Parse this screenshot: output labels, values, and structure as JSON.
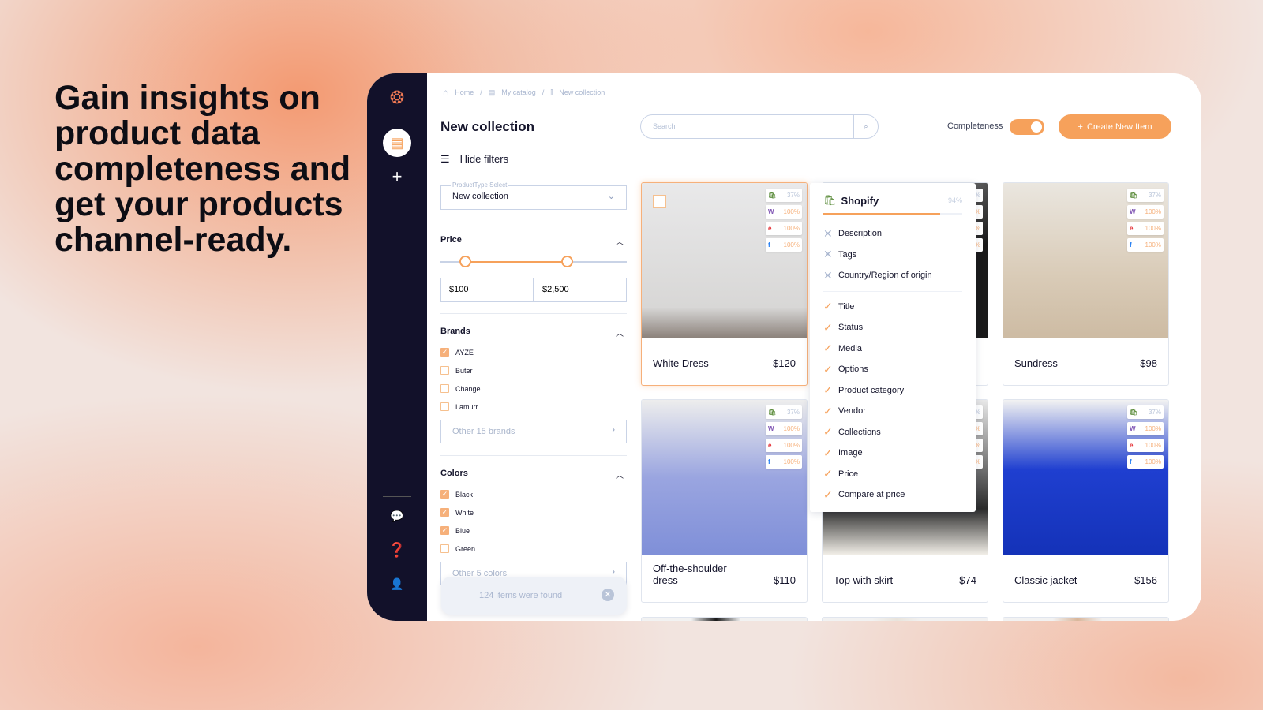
{
  "headline": "Gain insights on product data completeness and get your products channel-ready.",
  "breadcrumb": [
    "Home",
    "My catalog",
    "New collection"
  ],
  "page_title": "New collection",
  "search": {
    "placeholder": "Search"
  },
  "completeness": {
    "label": "Completeness",
    "enabled": true
  },
  "create_button": "Create New Item",
  "hide_filters": "Hide filters",
  "product_type": {
    "label": "ProductType Select",
    "value": "New collection"
  },
  "price": {
    "label": "Price",
    "min": "$100",
    "max": "$2,500"
  },
  "brands": {
    "label": "Brands",
    "items": [
      {
        "name": "AYZE",
        "checked": true
      },
      {
        "name": "Buter",
        "checked": false
      },
      {
        "name": "Change",
        "checked": false
      },
      {
        "name": "Lamurr",
        "checked": false
      }
    ],
    "more": "Other 15 brands"
  },
  "colors": {
    "label": "Colors",
    "items": [
      {
        "name": "Black",
        "checked": true
      },
      {
        "name": "White",
        "checked": true
      },
      {
        "name": "Blue",
        "checked": true
      },
      {
        "name": "Green",
        "checked": false
      }
    ],
    "more": "Other 5 colors"
  },
  "toast": "124 items were found",
  "channels": [
    "shopify",
    "woo",
    "ebay",
    "facebook"
  ],
  "products": [
    {
      "name": "White Dress",
      "price": "$120",
      "scores": [
        "37%",
        "100%",
        "100%",
        "100%"
      ],
      "selected": true
    },
    {
      "name": "",
      "price": "",
      "scores": [
        "37%",
        "100%",
        "100%",
        "100%"
      ]
    },
    {
      "name": "Sundress",
      "price": "$98",
      "scores": [
        "37%",
        "100%",
        "100%",
        "100%"
      ]
    },
    {
      "name": "Off-the-shoulder dress",
      "price": "$110",
      "scores": [
        "37%",
        "100%",
        "100%",
        "100%"
      ]
    },
    {
      "name": "Top with skirt",
      "price": "$74",
      "scores": [
        "37%",
        "100%",
        "100%",
        "100%"
      ]
    },
    {
      "name": "Classic jacket",
      "price": "$156",
      "scores": [
        "37%",
        "100%",
        "100%",
        "100%"
      ]
    }
  ],
  "popover": {
    "channel": "Shopify",
    "score": "94%",
    "missing": [
      "Description",
      "Tags",
      "Country/Region of origin"
    ],
    "complete": [
      "Title",
      "Status",
      "Media",
      "Options",
      "Product category",
      "Vendor",
      "Collections",
      "Image",
      "Price",
      "Compare at price"
    ]
  },
  "colors_theme": {
    "accent": "#f6a15b",
    "sidebar": "#12112a"
  }
}
